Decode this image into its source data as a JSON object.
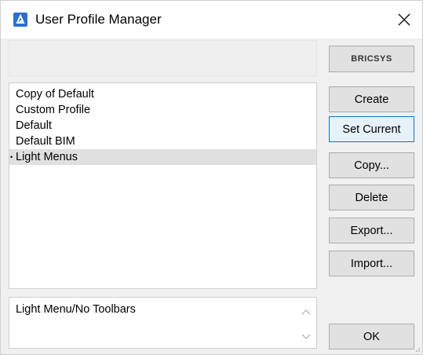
{
  "window": {
    "title": "User Profile Manager",
    "title_icon": "bricscad-app-icon",
    "close_icon": "close-icon"
  },
  "brand": {
    "label": "BRICSYS"
  },
  "profiles": {
    "items": [
      {
        "label": "Copy of Default",
        "current": false
      },
      {
        "label": "Custom Profile",
        "current": false
      },
      {
        "label": "Default",
        "current": false
      },
      {
        "label": "Default BIM",
        "current": false
      },
      {
        "label": "Light Menus",
        "current": true
      }
    ],
    "current_marker": "•"
  },
  "description": {
    "text": "Light Menu/No Toolbars"
  },
  "buttons": {
    "create": "Create",
    "set_current": "Set Current",
    "copy": "Copy...",
    "delete": "Delete",
    "export": "Export...",
    "import": "Import...",
    "ok": "OK"
  },
  "colors": {
    "accent": "#2a6fd6",
    "focus_border": "#0078d7",
    "selected_row": "#e0e0e0"
  }
}
